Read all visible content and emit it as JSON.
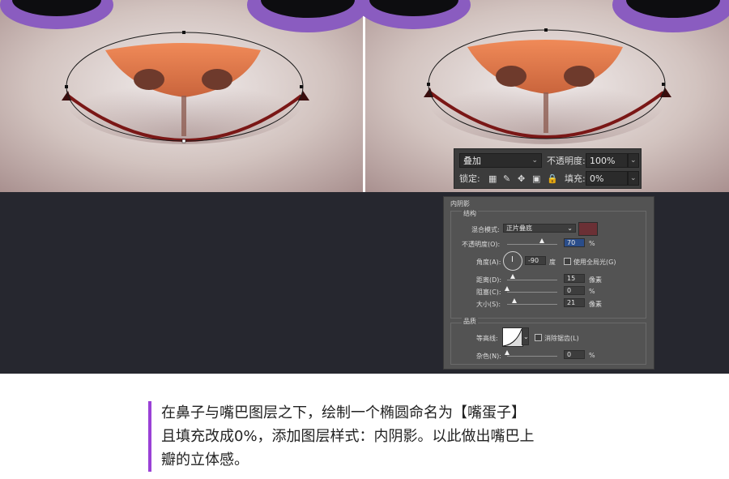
{
  "layers_bar": {
    "blend_mode": "叠加",
    "opacity_label": "不透明度:",
    "opacity_value": "100%",
    "lock_label": "锁定:",
    "fill_label": "填充:",
    "fill_value": "0%"
  },
  "inner_shadow_panel": {
    "title": "内阴影",
    "structure_title": "结构",
    "blend_mode_label": "混合模式:",
    "blend_mode_value": "正片叠底",
    "shadow_color": "#6b3035",
    "opacity_label": "不透明度(O):",
    "opacity_value": "70",
    "opacity_unit": "%",
    "opacity_fraction": 0.7,
    "angle_label": "角度(A):",
    "angle_value": "-90",
    "angle_unit": "度",
    "global_light_label": "使用全局光(G)",
    "distance_label": "距离(D):",
    "distance_value": "15",
    "distance_unit": "像素",
    "choke_label": "阻塞(C):",
    "choke_value": "0",
    "choke_unit": "%",
    "size_label": "大小(S):",
    "size_value": "21",
    "size_unit": "像素",
    "quality_title": "品质",
    "contour_label": "等高线:",
    "antialias_label": "消除锯齿(L)",
    "noise_label": "杂色(N):",
    "noise_value": "0",
    "noise_unit": "%"
  },
  "caption": {
    "line1": "在鼻子与嘴巴图层之下，绘制一个椭圆命名为【嘴蛋子】",
    "line2": "且填充改成0%，添加图层样式：内阴影。以此做出嘴巴上",
    "line3": "瓣的立体感。",
    "accent_color": "#9a41d6"
  },
  "colors": {
    "fur": "#c8b6b0",
    "purple": "#8a5cc0",
    "nose": "#e07a4c",
    "dark_bg": "#26272f"
  }
}
